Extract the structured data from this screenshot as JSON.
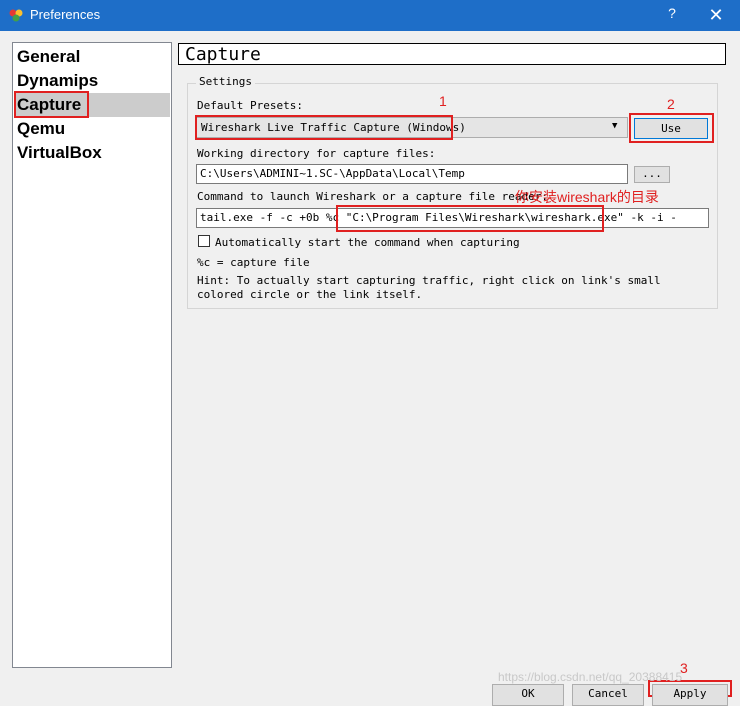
{
  "window": {
    "title": "Preferences",
    "help_label": "?",
    "close_label": "✕"
  },
  "sidebar": {
    "items": [
      {
        "label": "General"
      },
      {
        "label": "Dynamips"
      },
      {
        "label": "Capture"
      },
      {
        "label": "Qemu"
      },
      {
        "label": "VirtualBox"
      }
    ],
    "selected": "Capture"
  },
  "page": {
    "title": "Capture"
  },
  "settings": {
    "group_label": "Settings",
    "presets_label": "Default Presets:",
    "presets_value": "Wireshark Live Traffic Capture (Windows)",
    "use_label": "Use",
    "workdir_label": "Working directory for capture files:",
    "workdir_value": "C:\\Users\\ADMINI~1.SC-\\AppData\\Local\\Temp",
    "browse_label": "...",
    "command_label": "Command to launch Wireshark or a capture file reader:",
    "command_value": "tail.exe -f -c +0b %c  \"C:\\Program Files\\Wireshark\\wireshark.exe\" -k -i -",
    "auto_start_label": "Automatically start the command when capturing",
    "auto_start_checked": false,
    "capture_file_note": "%c = capture file",
    "hint": "Hint: To actually start capturing traffic, right click on link's small colored circle or the link itself."
  },
  "annotations": {
    "num1": "1",
    "num2": "2",
    "num3": "3",
    "install_note": "你安装wireshark的目录"
  },
  "footer": {
    "ok_label": "OK",
    "cancel_label": "Cancel",
    "apply_label": "Apply"
  },
  "watermark": "https://blog.csdn.net/qq_20388415",
  "colors": {
    "titlebar": "#1e6ec8",
    "annotation": "#e02020",
    "selection": "#cccccc",
    "use_focus": "#0078d7"
  }
}
